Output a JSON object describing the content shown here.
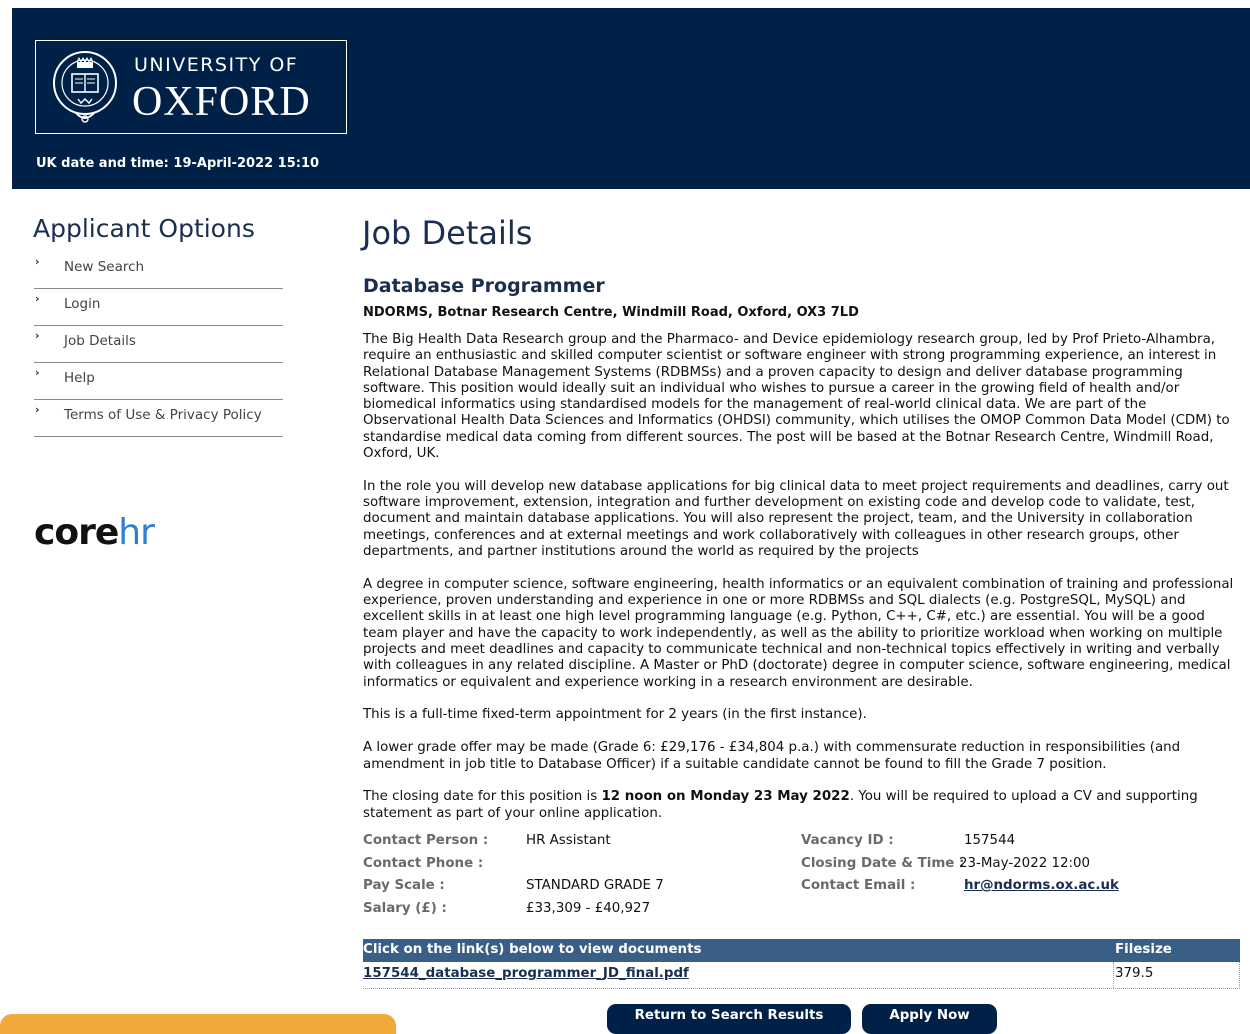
{
  "header": {
    "logo_line1": "UNIVERSITY OF",
    "logo_line2": "OXFORD",
    "datetime": "UK date and time: 19-April-2022 15:10",
    "bg_color": "#002147"
  },
  "sidebar": {
    "title": "Applicant Options",
    "items": [
      {
        "label": "New Search"
      },
      {
        "label": "Login"
      },
      {
        "label": "Job Details"
      },
      {
        "label": "Help"
      },
      {
        "label": "Terms of Use & Privacy Policy"
      }
    ],
    "brand_core": "core",
    "brand_hr": "hr"
  },
  "main": {
    "title": "Job Details",
    "job_title": "Database Programmer",
    "location": "NDORMS, Botnar Research Centre, Windmill Road, Oxford, OX3 7LD",
    "paragraphs": [
      " The Big Health Data Research group and the Pharmaco- and Device epidemiology research group, led by Prof Prieto-Alhambra, require an enthusiastic and skilled computer scientist or software engineer with strong programming experience, an interest in Relational Database Management Systems (RDBMSs) and a proven capacity to design and deliver database programming software. This position would ideally suit an individual who wishes to pursue a career in the growing field of health and/or biomedical informatics using standardised models for the management of real-world clinical data. We are part of the Observational Health Data Sciences and Informatics (OHDSI) community, which utilises the OMOP Common Data Model (CDM) to standardise medical data coming from different sources. The post will be based at the Botnar Research Centre, Windmill Road, Oxford, UK.",
      "In the role you will develop new database applications for big clinical data to meet project requirements and deadlines, carry out software improvement, extension, integration and further development on existing code and develop code to validate, test, document and maintain database applications. You will also represent the project, team, and the University in collaboration meetings, conferences and at external meetings and work collaboratively with colleagues in other research groups, other departments, and partner institutions around the world as required by the projects",
      "A degree in computer science, software engineering, health informatics or an equivalent combination of training and professional experience, proven understanding and experience in one or more RDBMSs and SQL dialects (e.g. PostgreSQL, MySQL) and excellent skills in at least one high level programming language (e.g. Python, C++, C#, etc.) are essential. You will be a good team player and have the capacity to work independently, as well as the ability to prioritize workload when working on multiple projects and meet deadlines and capacity to communicate technical and non-technical topics effectively in writing and verbally with colleagues in any related discipline. A Master or PhD (doctorate) degree in computer science, software engineering, medical informatics or equivalent and experience working in a research environment are desirable.",
      "This is a full-time fixed-term appointment for 2 years (in the first instance).",
      "A lower grade offer may be made (Grade 6: £29,176 - £34,804 p.a.) with commensurate reduction in responsibilities (and amendment in job title to Database Officer) if a suitable candidate cannot be found to fill the Grade 7 position."
    ],
    "closing_pre": "The closing date for this position is ",
    "closing_bold": "12 noon on Monday 23 May 2022",
    "closing_post": ". You will be required to upload a CV and supporting statement as part of your online application.",
    "info": {
      "contact_person_label": "Contact Person :",
      "contact_person": "HR Assistant",
      "contact_phone_label": "Contact Phone :",
      "contact_phone": "",
      "pay_scale_label": "Pay Scale :",
      "pay_scale": "STANDARD GRADE 7",
      "salary_label": "Salary (£) :",
      "salary": "£33,309 - £40,927",
      "vacancy_id_label": "Vacancy ID :",
      "vacancy_id": "157544",
      "closing_label": "Closing Date & Time :",
      "closing": "23-May-2022 12:00",
      "email_label": "Contact Email :",
      "email": "hr@ndorms.ox.ac.uk"
    },
    "documents": {
      "header": "Click on the link(s) below to view documents",
      "filesize_header": "Filesize",
      "rows": [
        {
          "name": "157544_database_programmer_JD_final.pdf",
          "size": "379.5"
        }
      ]
    },
    "buttons": {
      "return": "Return to Search Results",
      "apply": "Apply Now"
    }
  }
}
